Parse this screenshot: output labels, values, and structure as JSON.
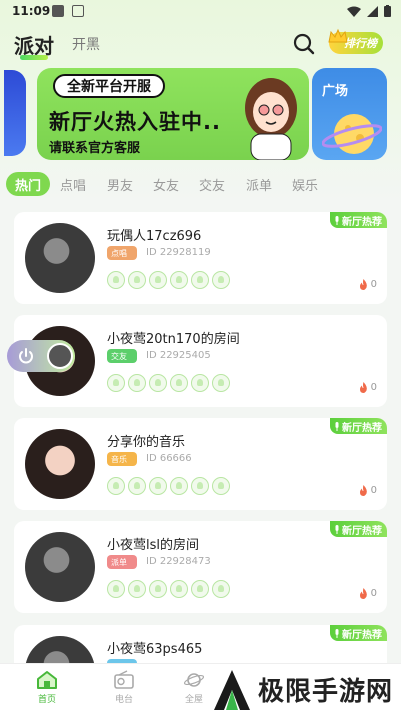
{
  "status_bar": {
    "time": "11:09"
  },
  "header": {
    "tabs": [
      {
        "label": "派对",
        "active": true
      },
      {
        "label": "开黑",
        "active": false
      }
    ],
    "rank_label": "排行榜"
  },
  "banner": {
    "pill": "全新平台开服",
    "headline": "新厅火热入驻中..",
    "subline": "请联系官方客服",
    "side_label": "广场"
  },
  "categories": [
    {
      "label": "热门",
      "active": true
    },
    {
      "label": "点唱",
      "active": false
    },
    {
      "label": "男友",
      "active": false
    },
    {
      "label": "女友",
      "active": false
    },
    {
      "label": "交友",
      "active": false
    },
    {
      "label": "派单",
      "active": false
    },
    {
      "label": "娱乐",
      "active": false
    }
  ],
  "rooms": [
    {
      "title": "玩偶人17cz696",
      "badge": "点唱",
      "badge_color": "#f0a56b",
      "id": "ID 22928119",
      "heat": "0",
      "tag": "新厅热荐",
      "avatar": "dark"
    },
    {
      "title": "小夜莺20tn170的房间",
      "badge": "交友",
      "badge_color": "#5ccf6b",
      "id": "ID 22925405",
      "heat": "0",
      "tag": "",
      "avatar": "girl"
    },
    {
      "title": "分享你的音乐",
      "badge": "音乐",
      "badge_color": "#f5b54a",
      "id": "ID 66666",
      "heat": "0",
      "tag": "新厅热荐",
      "avatar": "girl"
    },
    {
      "title": "小夜莺lsl的房间",
      "badge": "派单",
      "badge_color": "#f08a8a",
      "id": "ID 22928473",
      "heat": "0",
      "tag": "新厅热荐",
      "avatar": "dark"
    },
    {
      "title": "小夜莺63ps465",
      "badge": "",
      "badge_color": "#6cc6ea",
      "id": "",
      "heat": "",
      "tag": "新厅热荐",
      "avatar": "dark"
    }
  ],
  "tabbar": [
    {
      "label": "首页",
      "icon": "home-icon",
      "active": true
    },
    {
      "label": "电台",
      "icon": "radio-icon",
      "active": false
    },
    {
      "label": "全屋",
      "icon": "planet-icon",
      "active": false
    }
  ],
  "watermark": "极限手游网",
  "colors": {
    "accent": "#7fd84f",
    "tag_green": "#5ccf3c",
    "heat_red": "#f06a4a"
  }
}
